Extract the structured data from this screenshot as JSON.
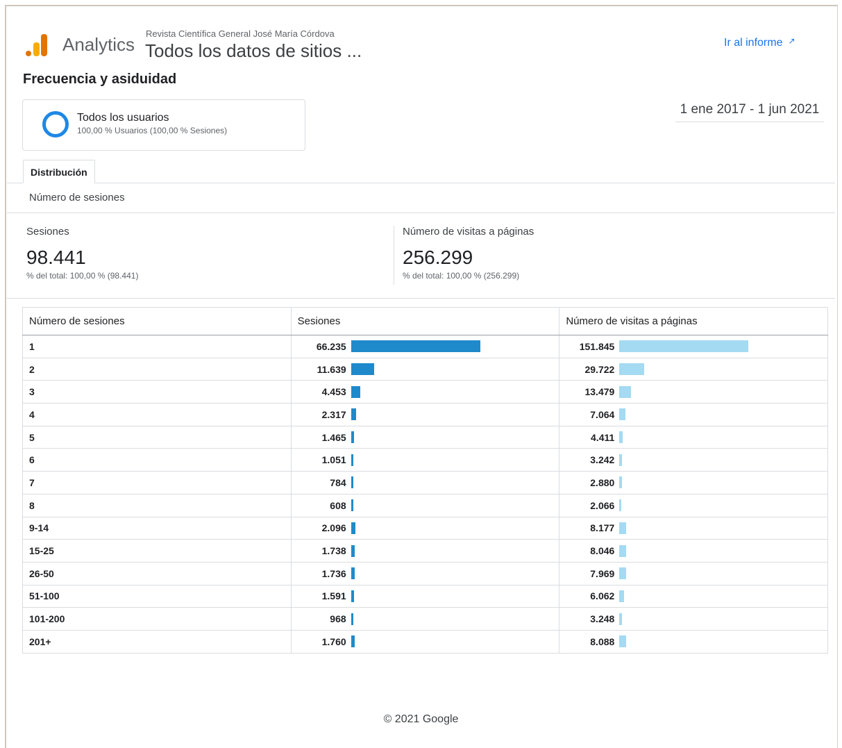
{
  "header": {
    "brand": "Analytics",
    "site_subtitle": "Revista Científica General José María Córdova",
    "site_title": "Todos los datos de sitios ...",
    "report_link": "Ir al informe",
    "report_link_icon": "external-link-icon"
  },
  "report": {
    "title": "Frecuencia y asiduidad",
    "date_range": "1 ene 2017 - 1 jun 2021"
  },
  "segment": {
    "name": "Todos los usuarios",
    "detail": "100,00 % Usuarios (100,00 % Sesiones)",
    "ring_color": "#1e88e5"
  },
  "tabs": [
    {
      "label": "Distribución",
      "active": true
    }
  ],
  "subheading": "Número de sesiones",
  "metrics": [
    {
      "label": "Sesiones",
      "value": "98.441",
      "pct": "% del total: 100,00 % (98.441)"
    },
    {
      "label": "Número de visitas a páginas",
      "value": "256.299",
      "pct": "% del total: 100,00 % (256.299)"
    }
  ],
  "table": {
    "columns": [
      "Número de sesiones",
      "Sesiones",
      "Número de visitas a páginas"
    ],
    "bar_colors": {
      "sessions": "#1f8acb",
      "pageviews": "#a4daf2"
    },
    "rows": [
      {
        "label": "1",
        "sessions": "66.235",
        "sessions_n": 66235,
        "pageviews": "151.845",
        "pageviews_n": 151845
      },
      {
        "label": "2",
        "sessions": "11.639",
        "sessions_n": 11639,
        "pageviews": "29.722",
        "pageviews_n": 29722
      },
      {
        "label": "3",
        "sessions": "4.453",
        "sessions_n": 4453,
        "pageviews": "13.479",
        "pageviews_n": 13479
      },
      {
        "label": "4",
        "sessions": "2.317",
        "sessions_n": 2317,
        "pageviews": "7.064",
        "pageviews_n": 7064
      },
      {
        "label": "5",
        "sessions": "1.465",
        "sessions_n": 1465,
        "pageviews": "4.411",
        "pageviews_n": 4411
      },
      {
        "label": "6",
        "sessions": "1.051",
        "sessions_n": 1051,
        "pageviews": "3.242",
        "pageviews_n": 3242
      },
      {
        "label": "7",
        "sessions": "784",
        "sessions_n": 784,
        "pageviews": "2.880",
        "pageviews_n": 2880
      },
      {
        "label": "8",
        "sessions": "608",
        "sessions_n": 608,
        "pageviews": "2.066",
        "pageviews_n": 2066
      },
      {
        "label": "9-14",
        "sessions": "2.096",
        "sessions_n": 2096,
        "pageviews": "8.177",
        "pageviews_n": 8177
      },
      {
        "label": "15-25",
        "sessions": "1.738",
        "sessions_n": 1738,
        "pageviews": "8.046",
        "pageviews_n": 8046
      },
      {
        "label": "26-50",
        "sessions": "1.736",
        "sessions_n": 1736,
        "pageviews": "7.969",
        "pageviews_n": 7969
      },
      {
        "label": "51-100",
        "sessions": "1.591",
        "sessions_n": 1591,
        "pageviews": "6.062",
        "pageviews_n": 6062
      },
      {
        "label": "101-200",
        "sessions": "968",
        "sessions_n": 968,
        "pageviews": "3.248",
        "pageviews_n": 3248
      },
      {
        "label": "201+",
        "sessions": "1.760",
        "sessions_n": 1760,
        "pageviews": "8.088",
        "pageviews_n": 8088
      }
    ]
  },
  "footer": "© 2021 Google"
}
